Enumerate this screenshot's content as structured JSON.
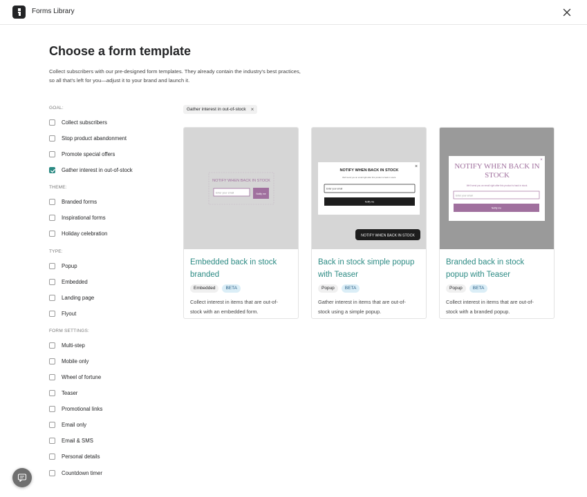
{
  "header": {
    "app_title": "Forms Library",
    "logo_icon": "klaviyo-logo-icon",
    "close_icon": "close-icon"
  },
  "page": {
    "title": "Choose a form template",
    "description_line1": "Collect subscribers with our pre-designed form templates. They already contain the industry's best practices,",
    "description_line2": "so all that's left for you—adjust it to your brand and launch it."
  },
  "filters": {
    "goal": {
      "label": "GOAL:",
      "items": [
        {
          "label": "Collect subscribers",
          "checked": false
        },
        {
          "label": "Stop product abandonment",
          "checked": false
        },
        {
          "label": "Promote special offers",
          "checked": false
        },
        {
          "label": "Gather interest in out-of-stock",
          "checked": true
        }
      ]
    },
    "theme": {
      "label": "THEME:",
      "items": [
        {
          "label": "Branded forms",
          "checked": false
        },
        {
          "label": "Inspirational forms",
          "checked": false
        },
        {
          "label": "Holiday celebration",
          "checked": false
        }
      ]
    },
    "type": {
      "label": "TYPE:",
      "items": [
        {
          "label": "Popup",
          "checked": false
        },
        {
          "label": "Embedded",
          "checked": false
        },
        {
          "label": "Landing page",
          "checked": false
        },
        {
          "label": "Flyout",
          "checked": false
        }
      ]
    },
    "settings": {
      "label": "FORM SETTINGS:",
      "items": [
        {
          "label": "Multi-step",
          "checked": false
        },
        {
          "label": "Mobile only",
          "checked": false
        },
        {
          "label": "Wheel of fortune",
          "checked": false
        },
        {
          "label": "Teaser",
          "checked": false
        },
        {
          "label": "Promotional links",
          "checked": false
        },
        {
          "label": "Email only",
          "checked": false
        },
        {
          "label": "Email & SMS",
          "checked": false
        },
        {
          "label": "Personal details",
          "checked": false
        },
        {
          "label": "Countdown timer",
          "checked": false
        }
      ]
    }
  },
  "active_filter": {
    "label": "Gather interest in out-of-stock",
    "remove": "×"
  },
  "cards": [
    {
      "title_line1": "Embedded back in stock",
      "title_line2": "branded",
      "type_tag": "Embedded",
      "beta_tag": "BETA",
      "desc_line1": "Collect interest in items that are out-of-",
      "desc_line2": "stock with an embedded form.",
      "preview": {
        "heading": "NOTIFY WHEN BACK IN STOCK",
        "input_placeholder": "Enter your email",
        "button": "Notify me"
      }
    },
    {
      "title_line1": "Back in stock simple popup",
      "title_line2": "with Teaser",
      "type_tag": "Popup",
      "beta_tag": "BETA",
      "desc_line1": "Gather interest in items that are out-of-",
      "desc_line2": "stock using a simple popup.",
      "preview": {
        "heading": "NOTIFY WHEN BACK IN STOCK",
        "subtext": "We'll send you an email right after this product is back in stock.",
        "input_placeholder": "Enter your email",
        "button": "Notify me",
        "teaser": "NOTIFY WHEN BACK IN STOCK",
        "close": "×"
      }
    },
    {
      "title_line1": "Branded back in stock",
      "title_line2": "popup with Teaser",
      "type_tag": "Popup",
      "beta_tag": "BETA",
      "desc_line1": "Collect interest in items that are out-of-",
      "desc_line2": "stock with a branded popup.",
      "preview": {
        "heading_line1": "NOTIFY WHEN BACK IN",
        "heading_line2": "STOCK",
        "subtext": "We'll send you an email right after this product is back in stock.",
        "input_placeholder": "Enter your email",
        "button": "Notify me",
        "close": "×"
      }
    }
  ],
  "colors": {
    "accent_teal": "#2b8a83",
    "brand_purple": "#a0709e",
    "preview_gray": "#d6d6d6",
    "preview_dark_gray": "#9a9a9a"
  },
  "chat": {
    "icon": "chat-icon"
  }
}
